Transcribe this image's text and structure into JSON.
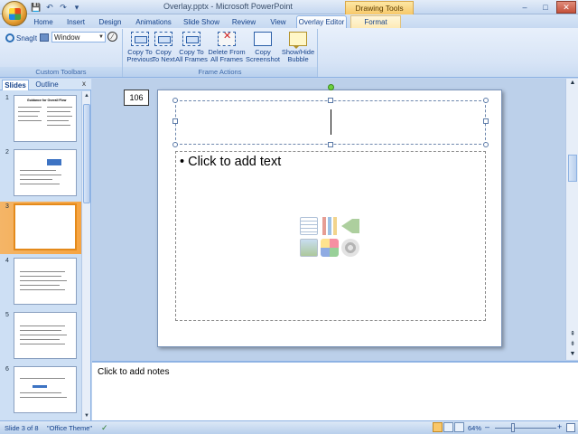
{
  "window": {
    "title": "Overlay.pptx - Microsoft PowerPoint",
    "context_tab_title": "Drawing Tools",
    "controls": [
      "–",
      "□",
      "✕"
    ]
  },
  "qat": [
    "💾",
    "↶",
    "↷",
    "▾"
  ],
  "tabs": [
    {
      "label": "Home"
    },
    {
      "label": "Insert"
    },
    {
      "label": "Design"
    },
    {
      "label": "Animations"
    },
    {
      "label": "Slide Show"
    },
    {
      "label": "Review"
    },
    {
      "label": "View"
    },
    {
      "label": "Overlay Editor",
      "active": true
    },
    {
      "label": "Format"
    }
  ],
  "ribbon": {
    "custom_toolbars": {
      "snagit_label": "SnagIt",
      "window_value": "Window",
      "group_label": "Custom Toolbars"
    },
    "frame_actions": {
      "group_label": "Frame Actions",
      "buttons": [
        {
          "line1": "Copy To",
          "line2": "Previous",
          "icon": "copy-to-previous-icon"
        },
        {
          "line1": "Copy",
          "line2": "To Next",
          "icon": "copy-to-next-icon"
        },
        {
          "line1": "Copy To",
          "line2": "All Frames",
          "icon": "copy-to-all-frames-icon"
        },
        {
          "line1": "Delete From",
          "line2": "All Frames",
          "icon": "delete-from-all-frames-icon"
        },
        {
          "line1": "Copy",
          "line2": "Screenshot",
          "icon": "copy-screenshot-icon"
        },
        {
          "line1": "Show/Hide",
          "line2": "Bubble",
          "icon": "bubble-icon"
        }
      ]
    }
  },
  "left_pane": {
    "tabs": [
      "Slides",
      "Outline"
    ],
    "close": "x",
    "slides": [
      {
        "number": "1",
        "heading": "Guidance for Overall Flow"
      },
      {
        "number": "2"
      },
      {
        "number": "3",
        "selected": true
      },
      {
        "number": "4"
      },
      {
        "number": "5"
      },
      {
        "number": "6"
      }
    ]
  },
  "slide": {
    "number_box": "106",
    "body_placeholder": "Click to add text",
    "bullet": "•"
  },
  "notes": {
    "placeholder": "Click to add notes"
  },
  "status": {
    "slide_info": "Slide 3 of 8",
    "theme": "\"Office Theme\"",
    "zoom": "64%",
    "zoom_minus": "–",
    "zoom_plus": "+"
  }
}
